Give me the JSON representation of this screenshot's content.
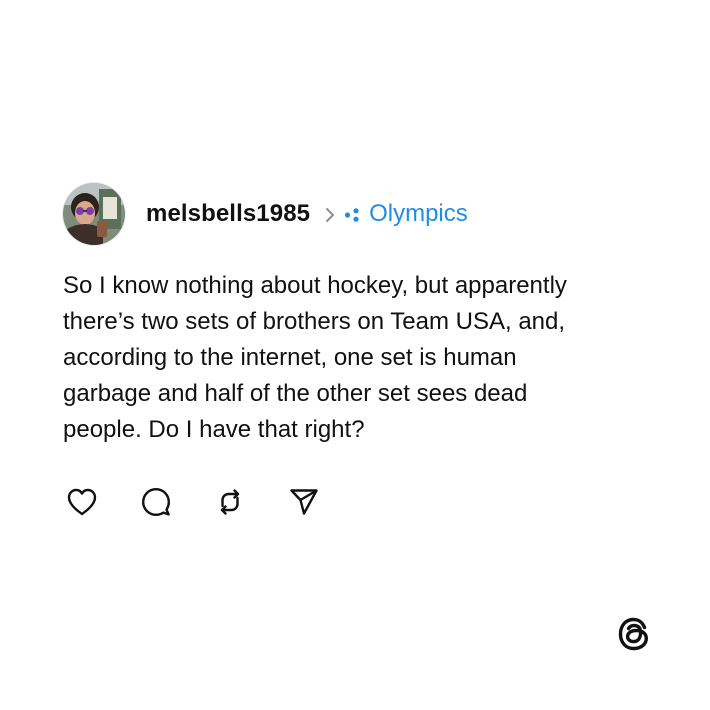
{
  "post": {
    "author": {
      "username": "melsbells1985",
      "avatar_icon": "profile-photo"
    },
    "separator_icon": "chevron-right-icon",
    "topic": {
      "icon": "topic-dots-icon",
      "label": "Olympics",
      "color": "#1f8de6"
    },
    "text": "So I know nothing about hockey, but apparently\nthere’s two sets of brothers on Team USA, and,\naccording to the internet, one set is human\ngarbage and half of the other set sees dead\npeople. Do I have that right?",
    "actions": [
      {
        "name": "like",
        "icon": "heart-icon"
      },
      {
        "name": "reply",
        "icon": "comment-icon"
      },
      {
        "name": "repost",
        "icon": "repost-icon"
      },
      {
        "name": "share",
        "icon": "send-icon"
      }
    ]
  },
  "branding": {
    "icon": "threads-logo-icon"
  },
  "colors": {
    "text": "#111111",
    "accent": "#1f8de6",
    "icon_stroke": "#111111",
    "background": "#ffffff"
  }
}
